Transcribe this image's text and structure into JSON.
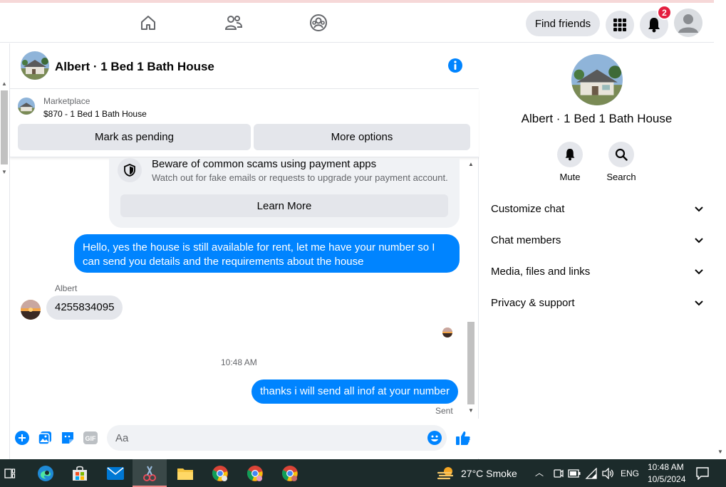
{
  "nav": {
    "find_friends": "Find friends",
    "notification_count": "2"
  },
  "chat": {
    "title": "Albert · 1 Bed 1 Bath House"
  },
  "marketplace": {
    "label": "Marketplace",
    "price_line": "$870 - 1 Bed 1 Bath House",
    "mark_pending": "Mark as pending",
    "more_options": "More options"
  },
  "scam_notice": {
    "title": "Beware of common scams using payment apps",
    "description": "Watch out for fake emails or requests to upgrade your payment account.",
    "learn_more": "Learn More"
  },
  "messages": {
    "outgoing_1": "Hello, yes the house is still available for rent, let me have your number so I can send you details and the requirements about the house",
    "sender": "Albert",
    "incoming_1": "4255834095",
    "timestamp": "10:48 AM",
    "outgoing_2": "thanks i will send all inof at your number",
    "status": "Sent"
  },
  "composer": {
    "placeholder": "Aa"
  },
  "info_panel": {
    "name": "Albert · 1 Bed 1 Bath House",
    "mute": "Mute",
    "search": "Search",
    "sections": [
      "Customize chat",
      "Chat members",
      "Media, files and links",
      "Privacy & support"
    ]
  },
  "taskbar": {
    "weather": "27°C  Smoke",
    "language": "ENG",
    "time": "10:48 AM",
    "date": "10/5/2024"
  },
  "colors": {
    "messenger_blue": "#0084ff",
    "badge_red": "#e41e3f",
    "taskbar": "#1c2b2b"
  }
}
